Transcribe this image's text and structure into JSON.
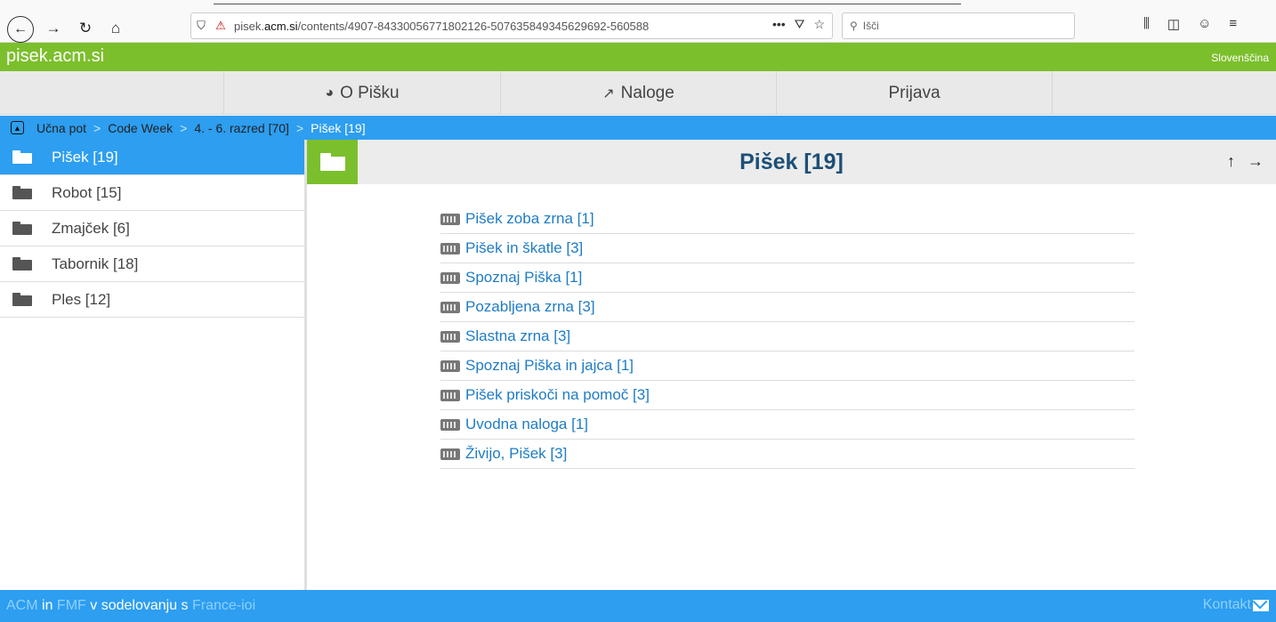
{
  "browser": {
    "url_prefix": "pisek.",
    "url_domain": "acm.si",
    "url_path": "/contents/4907-84330056771802126-507635849345629692-560588",
    "search_placeholder": "Išči"
  },
  "site": {
    "logo": "pisek.acm.si",
    "language": "Slovenščina"
  },
  "nav": {
    "about_label": "O Pišku",
    "tasks_label": "Naloge",
    "login_label": "Prijava"
  },
  "breadcrumb": {
    "items": [
      "Učna pot",
      "Code Week",
      "4. - 6. razred [70]"
    ],
    "current": "Pišek [19]",
    "separator": ">"
  },
  "sidebar": {
    "items": [
      {
        "label": "Pišek [19]",
        "active": true
      },
      {
        "label": "Robot [15]",
        "active": false
      },
      {
        "label": "Zmajček [6]",
        "active": false
      },
      {
        "label": "Tabornik [18]",
        "active": false
      },
      {
        "label": "Ples [12]",
        "active": false
      }
    ]
  },
  "content": {
    "title": "Pišek [19]",
    "tasks": [
      "Pišek zoba zrna [1]",
      "Pišek in škatle [3]",
      "Spoznaj Piška [1]",
      "Pozabljena zrna [3]",
      "Slastna zrna [3]",
      "Spoznaj Piška in jajca [1]",
      "Pišek priskoči na pomoč [3]",
      "Uvodna naloga [1]",
      "Živijo, Pišek [3]"
    ]
  },
  "footer": {
    "acm": "ACM",
    "and": "in",
    "fmf": "FMF",
    "middle": "v sodelovanju s",
    "france_ioi": "France-ioi",
    "contact": "Kontakt"
  },
  "colors": {
    "green": "#7cbf2c",
    "blue": "#2d9ef0",
    "title": "#1c4f78",
    "link": "#1f7cc4"
  }
}
